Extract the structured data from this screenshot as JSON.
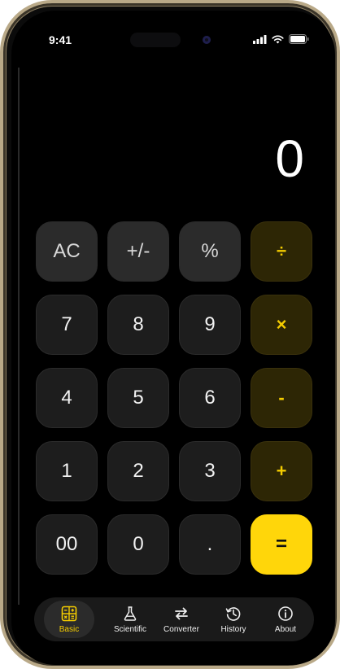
{
  "status": {
    "time": "9:41"
  },
  "display": {
    "value": "0"
  },
  "keys": {
    "row1": [
      "AC",
      "+/-",
      "%",
      "÷"
    ],
    "row2": [
      "7",
      "8",
      "9",
      "×"
    ],
    "row3": [
      "4",
      "5",
      "6",
      "-"
    ],
    "row4": [
      "1",
      "2",
      "3",
      "+"
    ],
    "row5": [
      "00",
      "0",
      ".",
      "="
    ]
  },
  "tabs": [
    {
      "label": "Basic",
      "icon": "calculator-icon",
      "active": true
    },
    {
      "label": "Scientific",
      "icon": "flask-icon",
      "active": false
    },
    {
      "label": "Converter",
      "icon": "swap-arrows-icon",
      "active": false
    },
    {
      "label": "History",
      "icon": "history-clock-icon",
      "active": false
    },
    {
      "label": "About",
      "icon": "info-circle-icon",
      "active": false
    }
  ],
  "colors": {
    "accent": "#FFD60A",
    "operator_bg": "#2D2605",
    "key_bg": "#1D1D1D",
    "function_bg": "#2B2B2B",
    "background": "#000000"
  }
}
